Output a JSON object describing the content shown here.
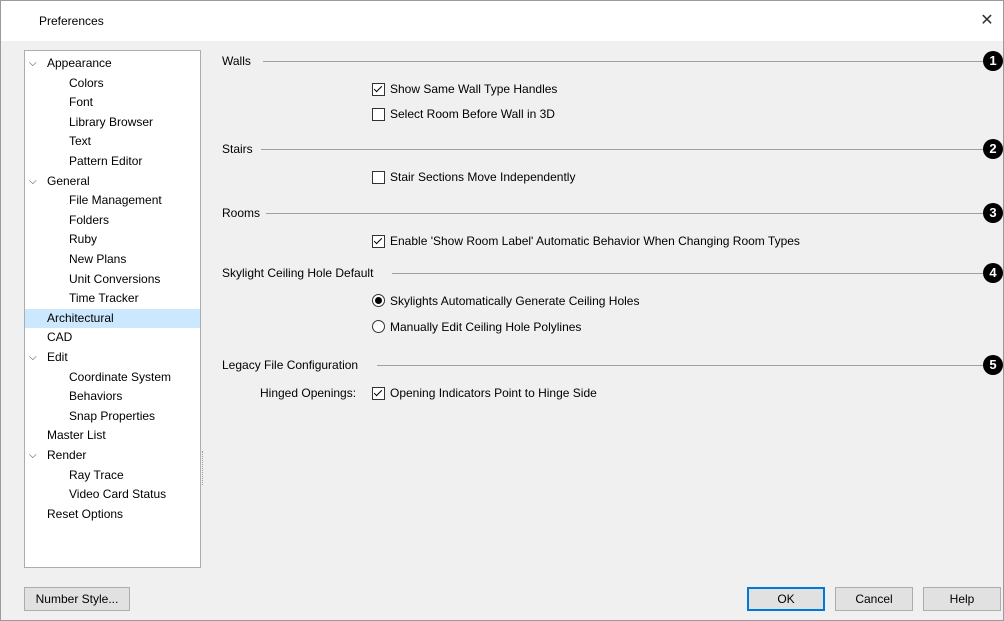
{
  "window": {
    "title": "Preferences",
    "close_glyph": "✕"
  },
  "tree": {
    "items": [
      {
        "label": "Appearance",
        "level": 0,
        "expander": "⌵"
      },
      {
        "label": "Colors",
        "level": 1
      },
      {
        "label": "Font",
        "level": 1
      },
      {
        "label": "Library Browser",
        "level": 1
      },
      {
        "label": "Text",
        "level": 1
      },
      {
        "label": "Pattern Editor",
        "level": 1
      },
      {
        "label": "General",
        "level": 0,
        "expander": "⌵"
      },
      {
        "label": "File Management",
        "level": 1
      },
      {
        "label": "Folders",
        "level": 1
      },
      {
        "label": "Ruby",
        "level": 1
      },
      {
        "label": "New Plans",
        "level": 1
      },
      {
        "label": "Unit Conversions",
        "level": 1
      },
      {
        "label": "Time Tracker",
        "level": 1
      },
      {
        "label": "Architectural",
        "level": 0,
        "selected": true
      },
      {
        "label": "CAD",
        "level": 0
      },
      {
        "label": "Edit",
        "level": 0,
        "expander": "⌵"
      },
      {
        "label": "Coordinate System",
        "level": 1
      },
      {
        "label": "Behaviors",
        "level": 1
      },
      {
        "label": "Snap Properties",
        "level": 1
      },
      {
        "label": "Master List",
        "level": 0
      },
      {
        "label": "Render",
        "level": 0,
        "expander": "⌵"
      },
      {
        "label": "Ray Trace",
        "level": 1
      },
      {
        "label": "Video Card Status",
        "level": 1
      },
      {
        "label": "Reset Options",
        "level": 0
      }
    ]
  },
  "sections": {
    "walls": {
      "title": "Walls",
      "callout": "1",
      "show_same_wall_type_handles": {
        "label": "Show Same Wall Type Handles",
        "checked": true
      },
      "select_room_before_wall_3d": {
        "label": "Select Room Before Wall in 3D",
        "checked": false
      }
    },
    "stairs": {
      "title": "Stairs",
      "callout": "2",
      "stair_sections_move_independently": {
        "label": "Stair Sections Move Independently",
        "checked": false
      }
    },
    "rooms": {
      "title": "Rooms",
      "callout": "3",
      "enable_show_room_label": {
        "label": "Enable 'Show Room Label' Automatic Behavior When Changing Room Types",
        "checked": true
      }
    },
    "skylight": {
      "title": "Skylight Ceiling Hole Default",
      "callout": "4",
      "auto_generate": {
        "label": "Skylights Automatically Generate Ceiling Holes",
        "selected": true
      },
      "manual_edit": {
        "label": "Manually Edit Ceiling Hole Polylines",
        "selected": false
      }
    },
    "legacy": {
      "title": "Legacy File Configuration",
      "callout": "5",
      "hinged_openings_label": "Hinged Openings:",
      "opening_indicators": {
        "label": "Opening Indicators Point to Hinge Side",
        "checked": true
      }
    }
  },
  "footer": {
    "number_style_label": "Number Style...",
    "ok_label": "OK",
    "cancel_label": "Cancel",
    "help_label": "Help"
  },
  "colors": {
    "selection": "#cce8ff",
    "default_button_border": "#0078d7"
  }
}
